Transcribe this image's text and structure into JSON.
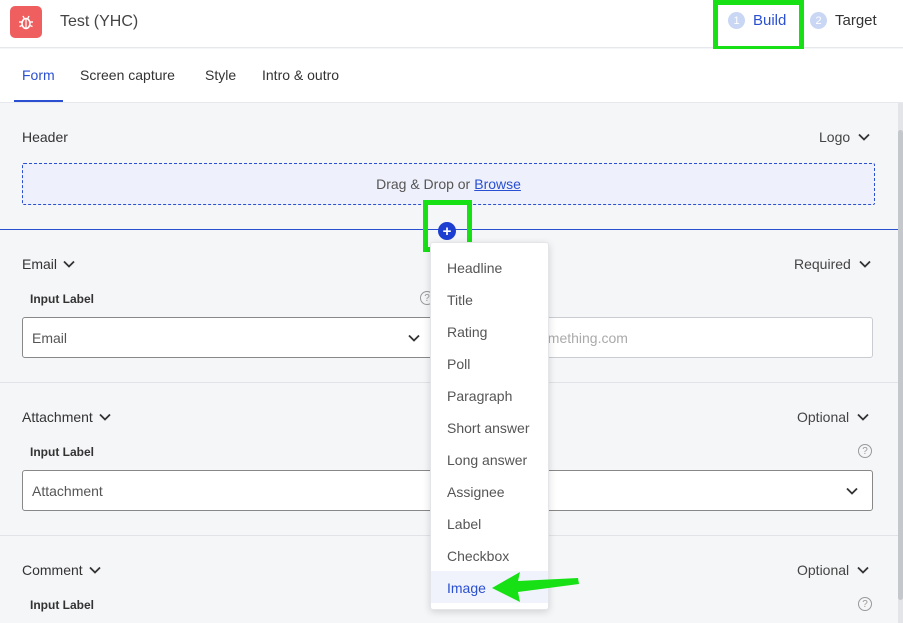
{
  "app": {
    "title": "Test (YHC)"
  },
  "steps": [
    {
      "num": "1",
      "label": "Build"
    },
    {
      "num": "2",
      "label": "Target"
    }
  ],
  "tabs": [
    {
      "label": "Form"
    },
    {
      "label": "Screen capture"
    },
    {
      "label": "Style"
    },
    {
      "label": "Intro & outro"
    }
  ],
  "header": {
    "title": "Header",
    "logo_label": "Logo",
    "drop_text": "Drag & Drop or",
    "browse_label": "Browse"
  },
  "email": {
    "title": "Email",
    "status": "Required",
    "input_label": "Input Label",
    "value": "Email",
    "placeholder": "omething.com"
  },
  "attachment": {
    "title": "Attachment",
    "status": "Optional",
    "input_label": "Input Label",
    "value": "Attachment"
  },
  "comment": {
    "title": "Comment",
    "status": "Optional",
    "input_label": "Input Label"
  },
  "menu": {
    "items": [
      "Headline",
      "Title",
      "Rating",
      "Poll",
      "Paragraph",
      "Short answer",
      "Long answer",
      "Assignee",
      "Label",
      "Checkbox",
      "Image"
    ]
  },
  "colors": {
    "accent": "#2a4fd1",
    "app_icon": "#ef5f5f",
    "highlight": "#17e015"
  },
  "icons": {
    "app": "bug-icon",
    "add": "plus-icon",
    "help": "help-circle-icon",
    "chevron": "chevron-down-icon",
    "pointer": "arrow-icon"
  }
}
